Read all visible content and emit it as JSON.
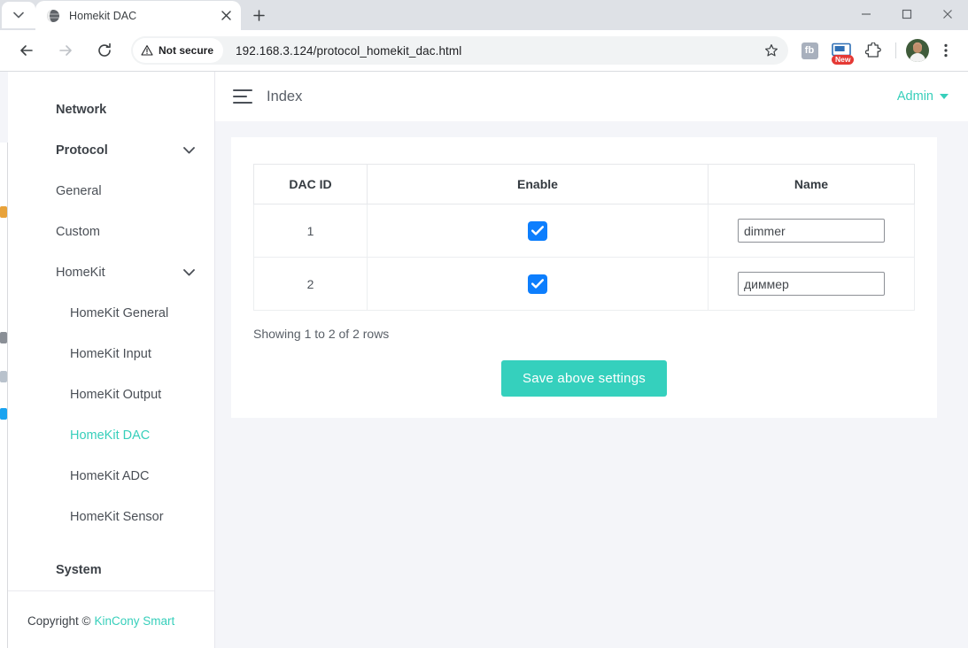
{
  "browser": {
    "tab": {
      "title": "Homekit DAC",
      "favicon": "globe-icon",
      "close": "×"
    },
    "newtab_label": "+",
    "tab_list_label": "v",
    "window_controls": {
      "minimize": "—",
      "maximize": "□",
      "close": "✕"
    },
    "toolbar": {
      "back": "←",
      "forward": "→",
      "reload": "⟳",
      "security_label": "Not secure",
      "url": "192.168.3.124/protocol_homekit_dac.html",
      "bookmark": "☆",
      "extensions": [
        {
          "name": "fb-extension-icon",
          "label": "fb",
          "badge": ""
        },
        {
          "name": "screenshot-extension-icon",
          "label": "",
          "badge": "New"
        },
        {
          "name": "puzzle-extensions-icon",
          "label": "",
          "badge": ""
        }
      ],
      "profile": "avatar",
      "menu": "⋮"
    }
  },
  "sidebar": {
    "items": [
      {
        "label": "Network",
        "type": "group",
        "expandable": false,
        "active": false
      },
      {
        "label": "Protocol",
        "type": "group",
        "expandable": true,
        "active": false
      },
      {
        "label": "General",
        "type": "sub",
        "expandable": false,
        "active": false
      },
      {
        "label": "Custom",
        "type": "sub",
        "expandable": false,
        "active": false
      },
      {
        "label": "HomeKit",
        "type": "sub",
        "expandable": true,
        "active": false
      },
      {
        "label": "HomeKit General",
        "type": "child",
        "expandable": false,
        "active": false
      },
      {
        "label": "HomeKit Input",
        "type": "child",
        "expandable": false,
        "active": false
      },
      {
        "label": "HomeKit Output",
        "type": "child",
        "expandable": false,
        "active": false
      },
      {
        "label": "HomeKit DAC",
        "type": "child",
        "expandable": false,
        "active": true
      },
      {
        "label": "HomeKit ADC",
        "type": "child",
        "expandable": false,
        "active": false
      },
      {
        "label": "HomeKit Sensor",
        "type": "child",
        "expandable": false,
        "active": false
      },
      {
        "label": "System",
        "type": "group",
        "expandable": false,
        "active": false
      }
    ],
    "footer": {
      "copyright": "Copyright ©",
      "brand": "KinCony Smart"
    }
  },
  "topbar": {
    "menu_icon": "hamburger-icon",
    "title": "Index",
    "admin_label": "Admin"
  },
  "table": {
    "headers": [
      "DAC ID",
      "Enable",
      "Name"
    ],
    "rows": [
      {
        "id": "1",
        "enabled": true,
        "name": "dimmer"
      },
      {
        "id": "2",
        "enabled": true,
        "name": "диммер"
      }
    ],
    "rows_info": "Showing 1 to 2 of 2 rows"
  },
  "actions": {
    "save_label": "Save above settings"
  },
  "colors": {
    "accent_teal": "#37cfbb",
    "save_button": "#35d0bd",
    "checkbox_blue": "#0d7efd",
    "page_bg": "#f4f5f9"
  }
}
